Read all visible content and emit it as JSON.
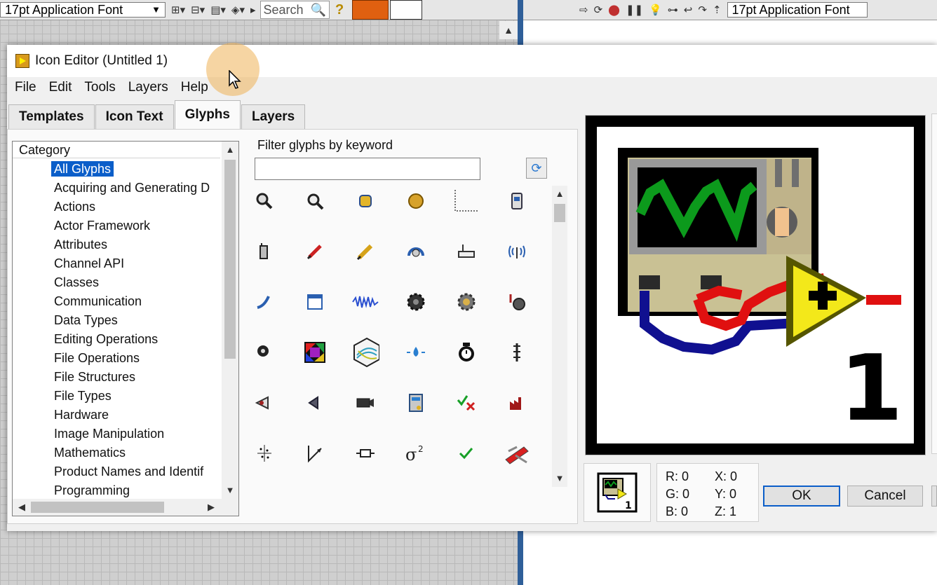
{
  "window": {
    "title": "Icon Editor (Untitled 1)"
  },
  "toolbar": {
    "font": "17pt Application Font",
    "search": "Search",
    "font_right": "17pt Application Font"
  },
  "menu": [
    "File",
    "Edit",
    "Tools",
    "Layers",
    "Help"
  ],
  "tabs": [
    {
      "label": "Templates",
      "active": false
    },
    {
      "label": "Icon Text",
      "active": false
    },
    {
      "label": "Glyphs",
      "active": true
    },
    {
      "label": "Layers",
      "active": false
    }
  ],
  "category": {
    "header": "Category",
    "items": [
      "All Glyphs",
      "Acquiring and Generating D",
      "Actions",
      "Actor Framework",
      "Attributes",
      "Channel API",
      "Classes",
      "Communication",
      "Data Types",
      "Editing Operations",
      "File Operations",
      "File Structures",
      "File Types",
      "Hardware",
      "Image Manipulation",
      "Mathematics",
      "Product Names and Identif",
      "Programming"
    ],
    "selected": "All Glyphs"
  },
  "filter": {
    "label": "Filter glyphs by keyword",
    "value": ""
  },
  "glyphs": [
    "zoom-1to1-icon",
    "zoom-fit-icon",
    "cylinder-tag-icon",
    "gold-circle-icon",
    "axes-icon",
    "usb-device-icon",
    "walkie-talkie-icon",
    "pen-red-icon",
    "pencil-icon",
    "rotary-knob-icon",
    "router-icon",
    "wireless-icon",
    "probe-icon",
    "window-icon",
    "waveform-icon",
    "gear-icon",
    "gear-shield-icon",
    "tap-icon",
    "disc-icon",
    "color-wheel-icon",
    "sphere-3d-icon",
    "droplet-icon",
    "stopwatch-icon",
    "ruler-icon",
    "eye-icon",
    "speaker-icon",
    "camera-icon",
    "server-icon",
    "check-x-icon",
    "factory-icon",
    "scatter-icon",
    "vector-icon",
    "resistor-icon",
    "sigma-squared-icon",
    "checkmark-icon",
    "swiss-knife-icon"
  ],
  "preview": {
    "label": "1"
  },
  "thumb": {
    "label": "1"
  },
  "coords": {
    "R": "R: 0",
    "G": "G: 0",
    "B": "B: 0",
    "X": "X: 0",
    "Y": "Y: 0",
    "Z": "Z: 1"
  },
  "buttons": {
    "ok": "OK",
    "cancel": "Cancel"
  },
  "colors": {
    "selection": "#0b5ec9",
    "divider": "#2f5f99"
  }
}
